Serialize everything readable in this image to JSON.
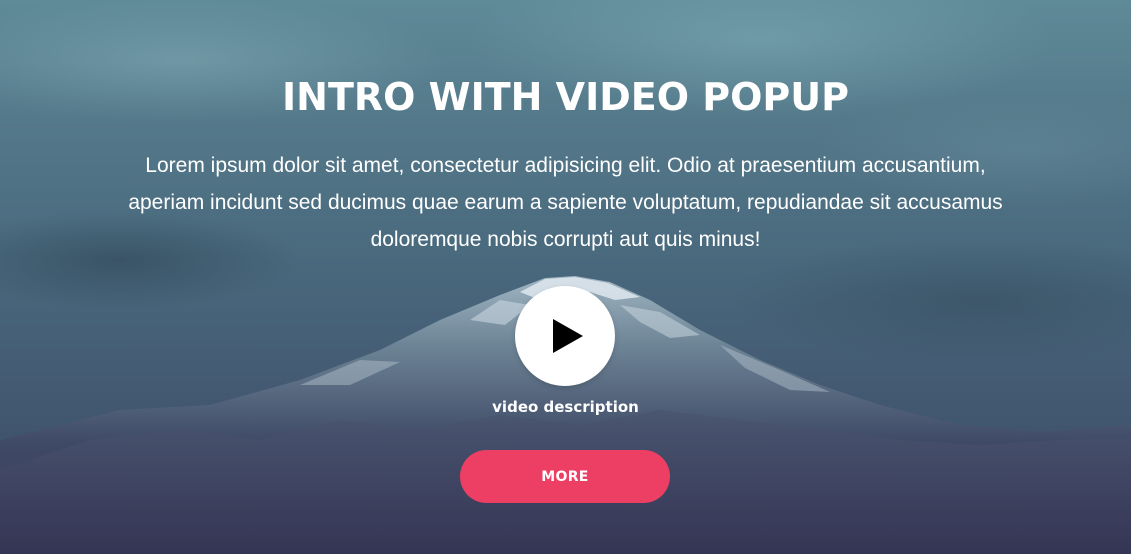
{
  "hero": {
    "title": "INTRO WITH VIDEO POPUP",
    "description_lines": [
      "Lorem ipsum dolor sit amet, consectetur adipisicing elit. Odio at praesentium accusantium,",
      "aperiam incidunt sed ducimus quae earum a sapiente voluptatum, repudiandae sit accusamus",
      "doloremque nobis corrupti aut quis minus!"
    ],
    "video": {
      "icon": "play-icon",
      "description": "video description"
    },
    "more_button_label": "MORE"
  },
  "colors": {
    "accent": "#ed3f63",
    "text": "#ffffff",
    "play_button_bg": "#ffffff",
    "play_icon": "#000000"
  }
}
